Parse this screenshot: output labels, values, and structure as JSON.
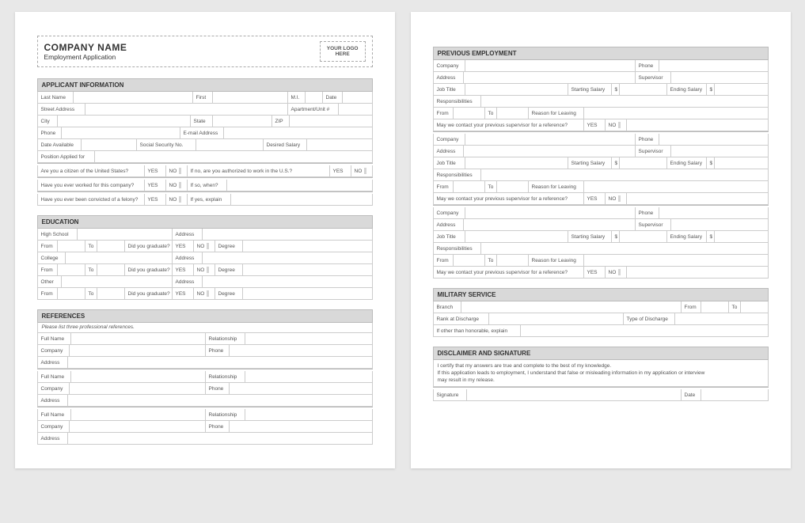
{
  "header": {
    "company": "COMPANY NAME",
    "subtitle": "Employment Application",
    "logo_line1": "YOUR LOGO",
    "logo_line2": "HERE"
  },
  "sections": {
    "applicant_info": "APPLICANT INFORMATION",
    "education": "EDUCATION",
    "references": "REFERENCES",
    "previous_employment": "PREVIOUS EMPLOYMENT",
    "military": "MILITARY SERVICE",
    "disclaimer": "DISCLAIMER  AND SIGNATURE"
  },
  "labels": {
    "last_name": "Last Name",
    "first": "First",
    "mi": "M.I.",
    "date": "Date",
    "street_address": "Street Address",
    "apt": "Apartment/Unit  #",
    "city": "City",
    "state": "State",
    "zip": "ZIP",
    "phone": "Phone",
    "email": "E-mail Address",
    "date_available": "Date Available",
    "ssn": "Social Security No.",
    "desired_salary": "Desired Salary",
    "position": "Position Applied for",
    "citizen_q": "Are you a citizen of the United States?",
    "authorized_q": "If no, are you authorized  to work in the U.S.?",
    "worked_q": "Have you ever worked for this company?",
    "if_so_when": "If so, when?",
    "felony_q": "Have you ever been convicted of a felony?",
    "if_yes_explain": "If yes, explain",
    "yes": "YES",
    "no": "NO",
    "high_school": "High School",
    "college": "College",
    "other": "Other",
    "address": "Address",
    "from": "From",
    "to": "To",
    "graduate_q": "Did you graduate?",
    "degree": "Degree",
    "ref_note": "Please list three professional references.",
    "full_name": "Full Name",
    "relationship": "Relationship",
    "company": "Company",
    "job_title": "Job Title",
    "supervisor": "Supervisor",
    "starting_salary": "Starting Salary",
    "ending_salary": "Ending Salary",
    "dollar": "$",
    "responsibilities": "Responsibilities",
    "reason_leaving": "Reason for Leaving",
    "contact_q": "May we contact your previous supervisor for a reference?",
    "branch": "Branch",
    "rank": "Rank at Discharge",
    "type_discharge": "Type of Discharge",
    "other_honorable": "If other than honorable,  explain",
    "disc_line1": "I certify  that my answers are true and complete  to the best of my knowledge.",
    "disc_line2": "If this application  leads to employment,  I understand  that false or misleading  information  in my application  or interview",
    "disc_line3": "may result in my release.",
    "signature": "Signature",
    "date2": "Date"
  }
}
